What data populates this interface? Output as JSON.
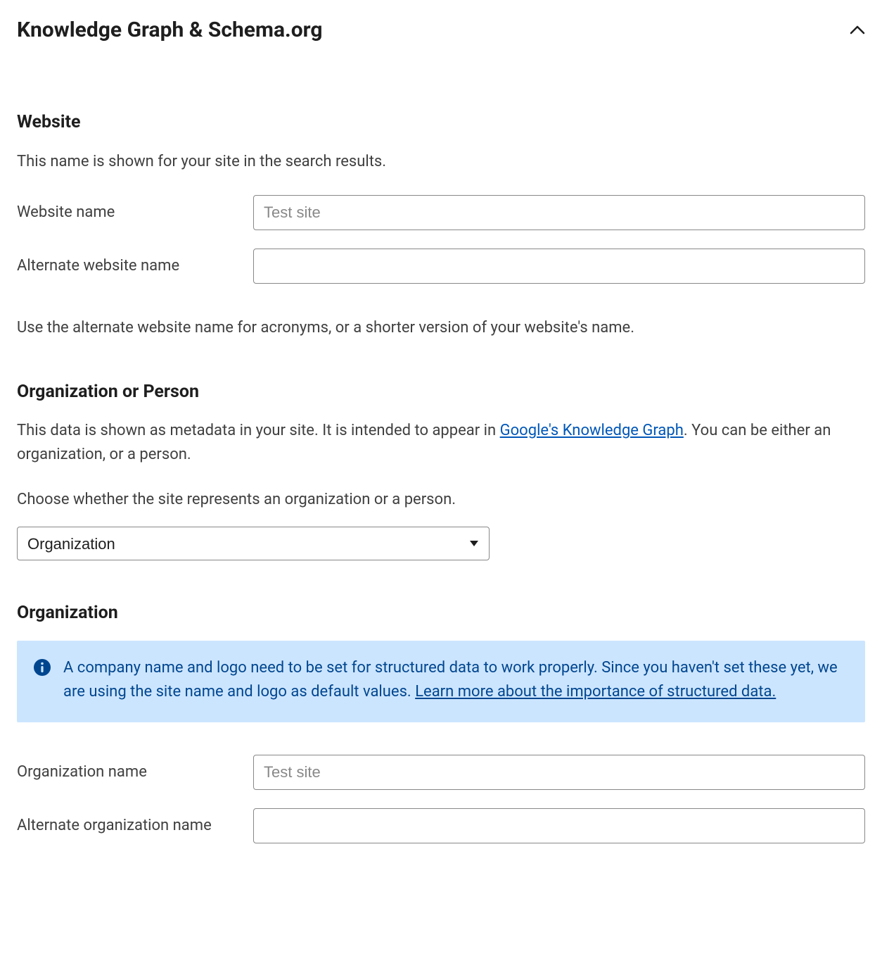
{
  "panel": {
    "title": "Knowledge Graph & Schema.org"
  },
  "website": {
    "heading": "Website",
    "desc": "This name is shown for your site in the search results.",
    "name_label": "Website name",
    "name_placeholder": "Test site",
    "name_value": "",
    "alt_label": "Alternate website name",
    "alt_value": "",
    "hint": "Use the alternate website name for acronyms, or a shorter version of your website's name."
  },
  "org_person": {
    "heading": "Organization or Person",
    "desc_pre": "This data is shown as metadata in your site. It is intended to appear in ",
    "desc_link": "Google's Knowledge Graph",
    "desc_post": ". You can be either an organization, or a person.",
    "prompt": "Choose whether the site represents an organization or a person.",
    "selected": "Organization"
  },
  "organization": {
    "heading": "Organization",
    "info_text": "A company name and logo need to be set for structured data to work properly. Since you haven't set these yet, we are using the site name and logo as default values. ",
    "info_link": "Learn more about the importance of structured data.",
    "name_label": "Organization name",
    "name_placeholder": "Test site",
    "name_value": "",
    "alt_label": "Alternate organization name",
    "alt_value": ""
  },
  "colors": {
    "link": "#0057b8",
    "info_bg": "#cce5ff",
    "info_fg": "#00468f"
  }
}
